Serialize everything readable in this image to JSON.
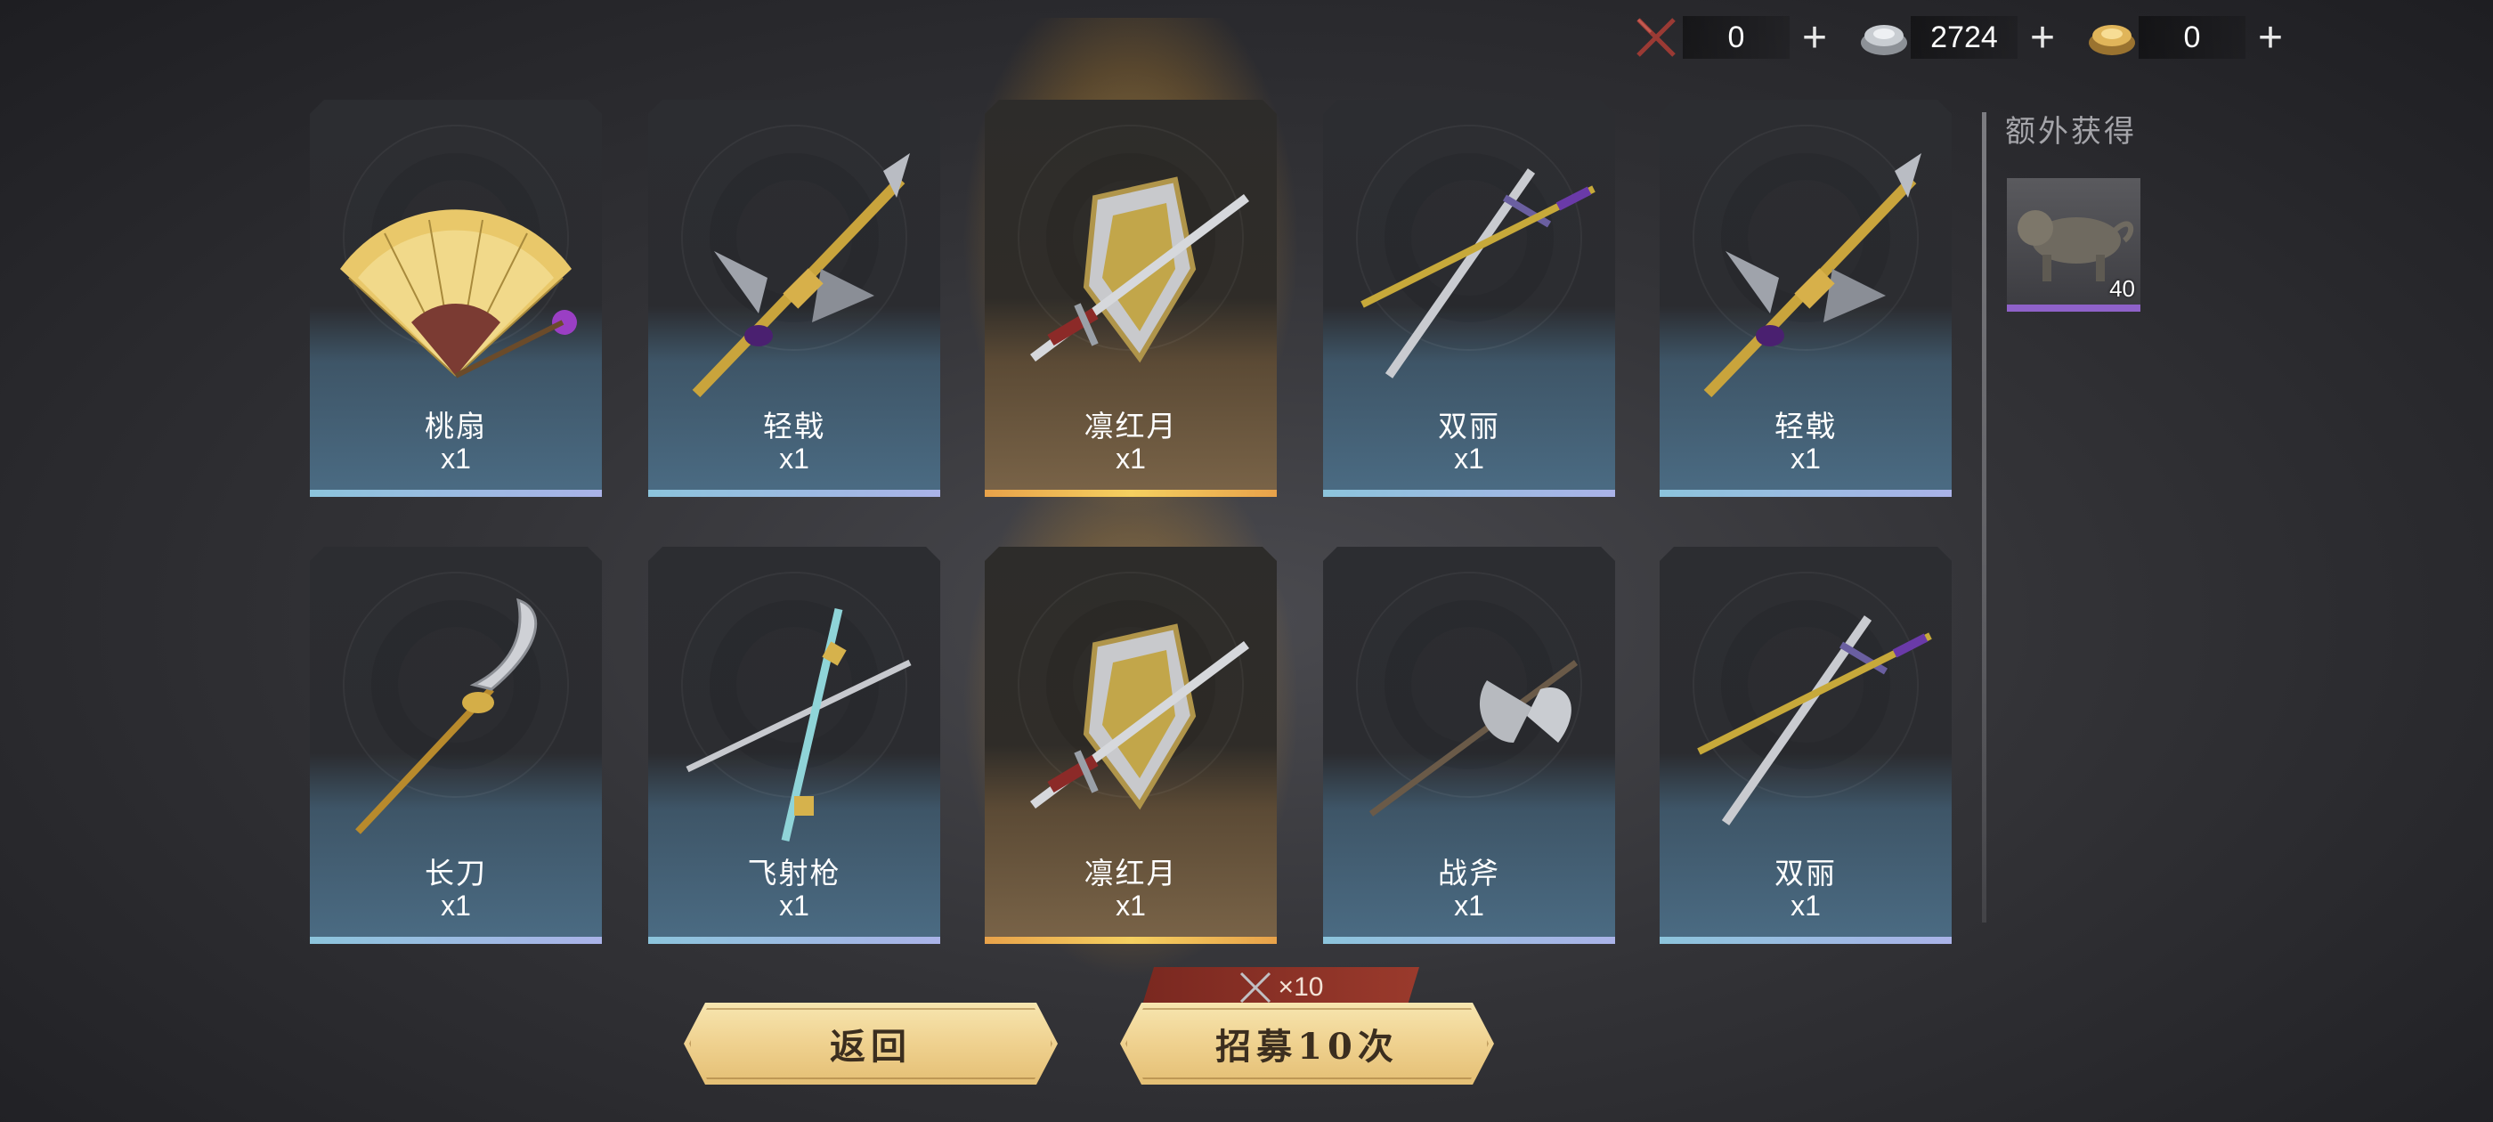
{
  "currency": [
    {
      "icon": "crossed-swords-icon",
      "value": "0",
      "plus": "+"
    },
    {
      "icon": "silver-ingot-icon",
      "value": "2724",
      "plus": "+"
    },
    {
      "icon": "gold-ingot-icon",
      "value": "0",
      "plus": "+"
    }
  ],
  "cards": [
    {
      "name": "桃扇",
      "qty": "x1",
      "rarity": "blue",
      "icon": "folding-fan-icon"
    },
    {
      "name": "轻戟",
      "qty": "x1",
      "rarity": "blue",
      "icon": "halberd-icon"
    },
    {
      "name": "凛红月",
      "qty": "x1",
      "rarity": "gold",
      "icon": "sword-and-shield-icon"
    },
    {
      "name": "双丽",
      "qty": "x1",
      "rarity": "blue",
      "icon": "twin-swords-icon"
    },
    {
      "name": "轻戟",
      "qty": "x1",
      "rarity": "blue",
      "icon": "halberd-icon"
    },
    {
      "name": "长刀",
      "qty": "x1",
      "rarity": "blue",
      "icon": "glaive-icon"
    },
    {
      "name": "飞射枪",
      "qty": "x1",
      "rarity": "blue",
      "icon": "twin-spears-icon"
    },
    {
      "name": "凛红月",
      "qty": "x1",
      "rarity": "gold",
      "icon": "sword-and-shield-icon"
    },
    {
      "name": "战斧",
      "qty": "x1",
      "rarity": "blue",
      "icon": "battle-axe-icon"
    },
    {
      "name": "双丽",
      "qty": "x1",
      "rarity": "blue",
      "icon": "twin-swords-icon"
    }
  ],
  "extra": {
    "title": "额外获得",
    "item": {
      "icon": "bronze-beast-icon",
      "count": "40"
    }
  },
  "buttons": {
    "back": "返回",
    "recruit": "招募10次",
    "cost": "×10"
  },
  "colors": {
    "blue_rarity": "#8cc4dc",
    "gold_rarity": "#f5d060",
    "purple_rarity": "#8f62c9",
    "button": "#efd18f"
  }
}
